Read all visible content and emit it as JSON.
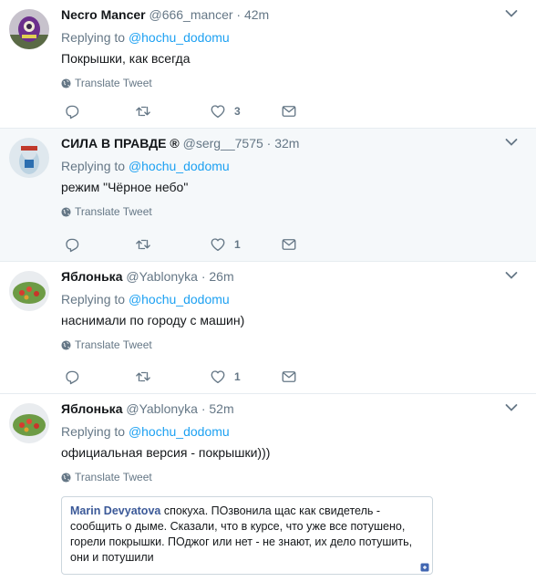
{
  "common": {
    "replying_prefix": "Replying to",
    "translate_label": "Translate Tweet"
  },
  "tweets": [
    {
      "name": "Necro Mancer",
      "handle": "@666_mancer",
      "dot": "·",
      "time": "42m",
      "replying_to": "@hochu_dodomu",
      "text": "Покрышки, как всегда",
      "likes": "3"
    },
    {
      "name": "СИЛА В ПРАВДЕ ®",
      "handle": "@serg__7575",
      "dot": "·",
      "time": "32m",
      "replying_to": "@hochu_dodomu",
      "text": "режим \"Чёрное небо\"",
      "likes": "1"
    },
    {
      "name": "Яблонька",
      "handle": "@Yablonyka",
      "dot": "·",
      "time": "26m",
      "replying_to": "@hochu_dodomu",
      "text": "наснимали по городу с машин)",
      "likes": "1"
    },
    {
      "name": "Яблонька",
      "handle": "@Yablonyka",
      "dot": "·",
      "time": "52m",
      "replying_to": "@hochu_dodomu",
      "text": "официальная версия - покрышки)))",
      "quote": {
        "author": "Marin Devyatova",
        "line1": " спокуха. ПОзвонила щас как свидетель -",
        "line2": "сообщить о дыме. Сказали, что в курсе, что уже все потушено,",
        "line3": "горели покрышки. ПОджог или нет - не знают, их дело потушить,",
        "line4": "они и потушили"
      }
    }
  ],
  "colors": {
    "link": "#1da1f2",
    "muted": "#657786",
    "highlight_bg": "#f5f8fa",
    "fb_author": "#3b5998"
  }
}
